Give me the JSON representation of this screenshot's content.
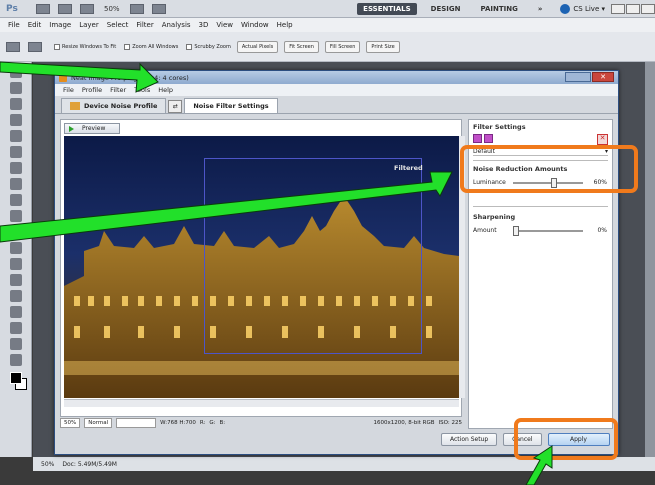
{
  "photoshop": {
    "logo": "Ps",
    "zoom": "50%",
    "workspaces": [
      "ESSENTIALS",
      "DESIGN",
      "PAINTING",
      "»"
    ],
    "cslive": "CS Live ▾",
    "menu": [
      "File",
      "Edit",
      "Image",
      "Layer",
      "Select",
      "Filter",
      "Analysis",
      "3D",
      "View",
      "Window",
      "Help"
    ],
    "options": {
      "resize_windows": "Resize Windows To Fit",
      "zoom_all": "Zoom All Windows",
      "scrubby": "Scrubby Zoom",
      "buttons": [
        "Actual Pixels",
        "Fit Screen",
        "Fill Screen",
        "Print Size"
      ]
    },
    "status": {
      "zoom": "50%",
      "doc": "Doc: 5.49M/5.49M"
    }
  },
  "plugin": {
    "title": "Neat Image Pro plug-in (x4: 4 cores)",
    "menu": [
      "File",
      "Profile",
      "Filter",
      "Tools",
      "Help"
    ],
    "tabs": {
      "device_profile": "Device Noise Profile",
      "filter_settings": "Noise Filter Settings"
    },
    "preview": {
      "button": "Preview",
      "filtered_label": "Filtered"
    },
    "bottom": {
      "zoom": "50%",
      "mode": "Normal",
      "coords": "W:768 H:700",
      "r": "R:",
      "g": "G:",
      "b": "B:",
      "image_info": "1600x1200, 8-bit RGB",
      "iso": "ISO: 225"
    },
    "settings": {
      "header": "Filter Settings",
      "preset": "Default",
      "noise_reduction": {
        "title": "Noise Reduction Amounts",
        "luminance_label": "Luminance",
        "luminance_value": "60%",
        "luminance_level": 0.6
      },
      "sharpening": {
        "title": "Sharpening",
        "amount_label": "Amount",
        "amount_value": "0%",
        "amount_level": 0.0
      }
    },
    "buttons": {
      "action_setup": "Action Setup",
      "cancel": "Cancel",
      "apply": "Apply"
    }
  },
  "colors": {
    "highlight": "#f07a1c",
    "arrow": "#22e02a"
  }
}
